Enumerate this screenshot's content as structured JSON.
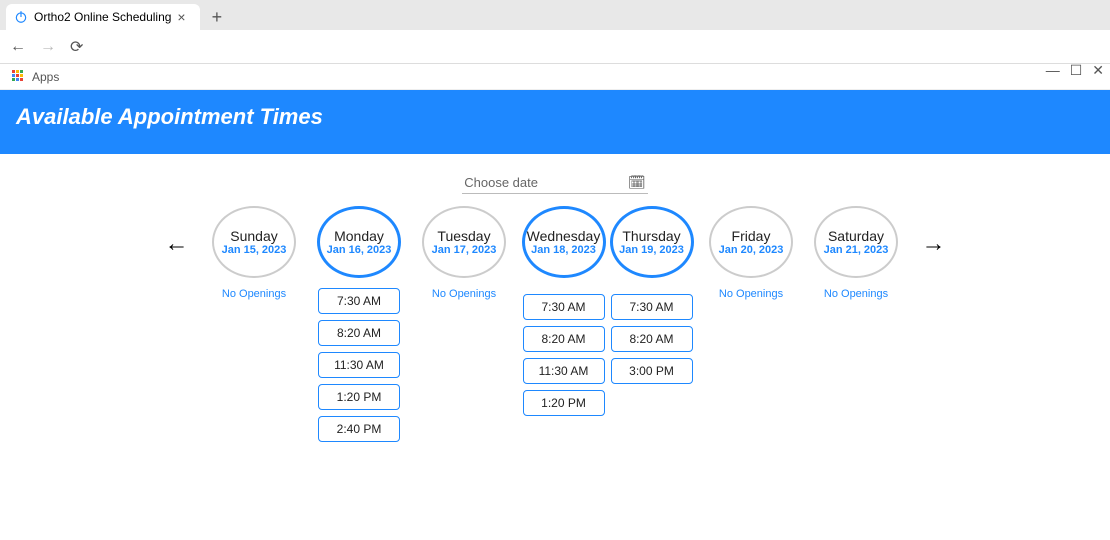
{
  "browser": {
    "tab_title": "Ortho2 Online Scheduling",
    "bookmarks_label": "Apps"
  },
  "header": {
    "title": "Available Appointment Times"
  },
  "date_picker": {
    "label": "Choose date"
  },
  "no_openings_label": "No Openings",
  "days": [
    {
      "name": "Sunday",
      "date": "Jan 15, 2023",
      "available": false,
      "slots": []
    },
    {
      "name": "Monday",
      "date": "Jan 16, 2023",
      "available": true,
      "slots": [
        "7:30 AM",
        "8:20 AM",
        "11:30 AM",
        "1:20 PM",
        "2:40 PM"
      ]
    },
    {
      "name": "Tuesday",
      "date": "Jan 17, 2023",
      "available": false,
      "slots": []
    },
    {
      "name": "Wednesday",
      "date": "Jan 18, 2023",
      "available": true,
      "slots": [
        "7:30 AM",
        "8:20 AM",
        "11:30 AM",
        "1:20 PM"
      ],
      "pair_with_next": true
    },
    {
      "name": "Thursday",
      "date": "Jan 19, 2023",
      "available": true,
      "slots": [
        "7:30 AM",
        "8:20 AM",
        "3:00 PM"
      ]
    },
    {
      "name": "Friday",
      "date": "Jan 20, 2023",
      "available": false,
      "slots": []
    },
    {
      "name": "Saturday",
      "date": "Jan 21, 2023",
      "available": false,
      "slots": []
    }
  ]
}
